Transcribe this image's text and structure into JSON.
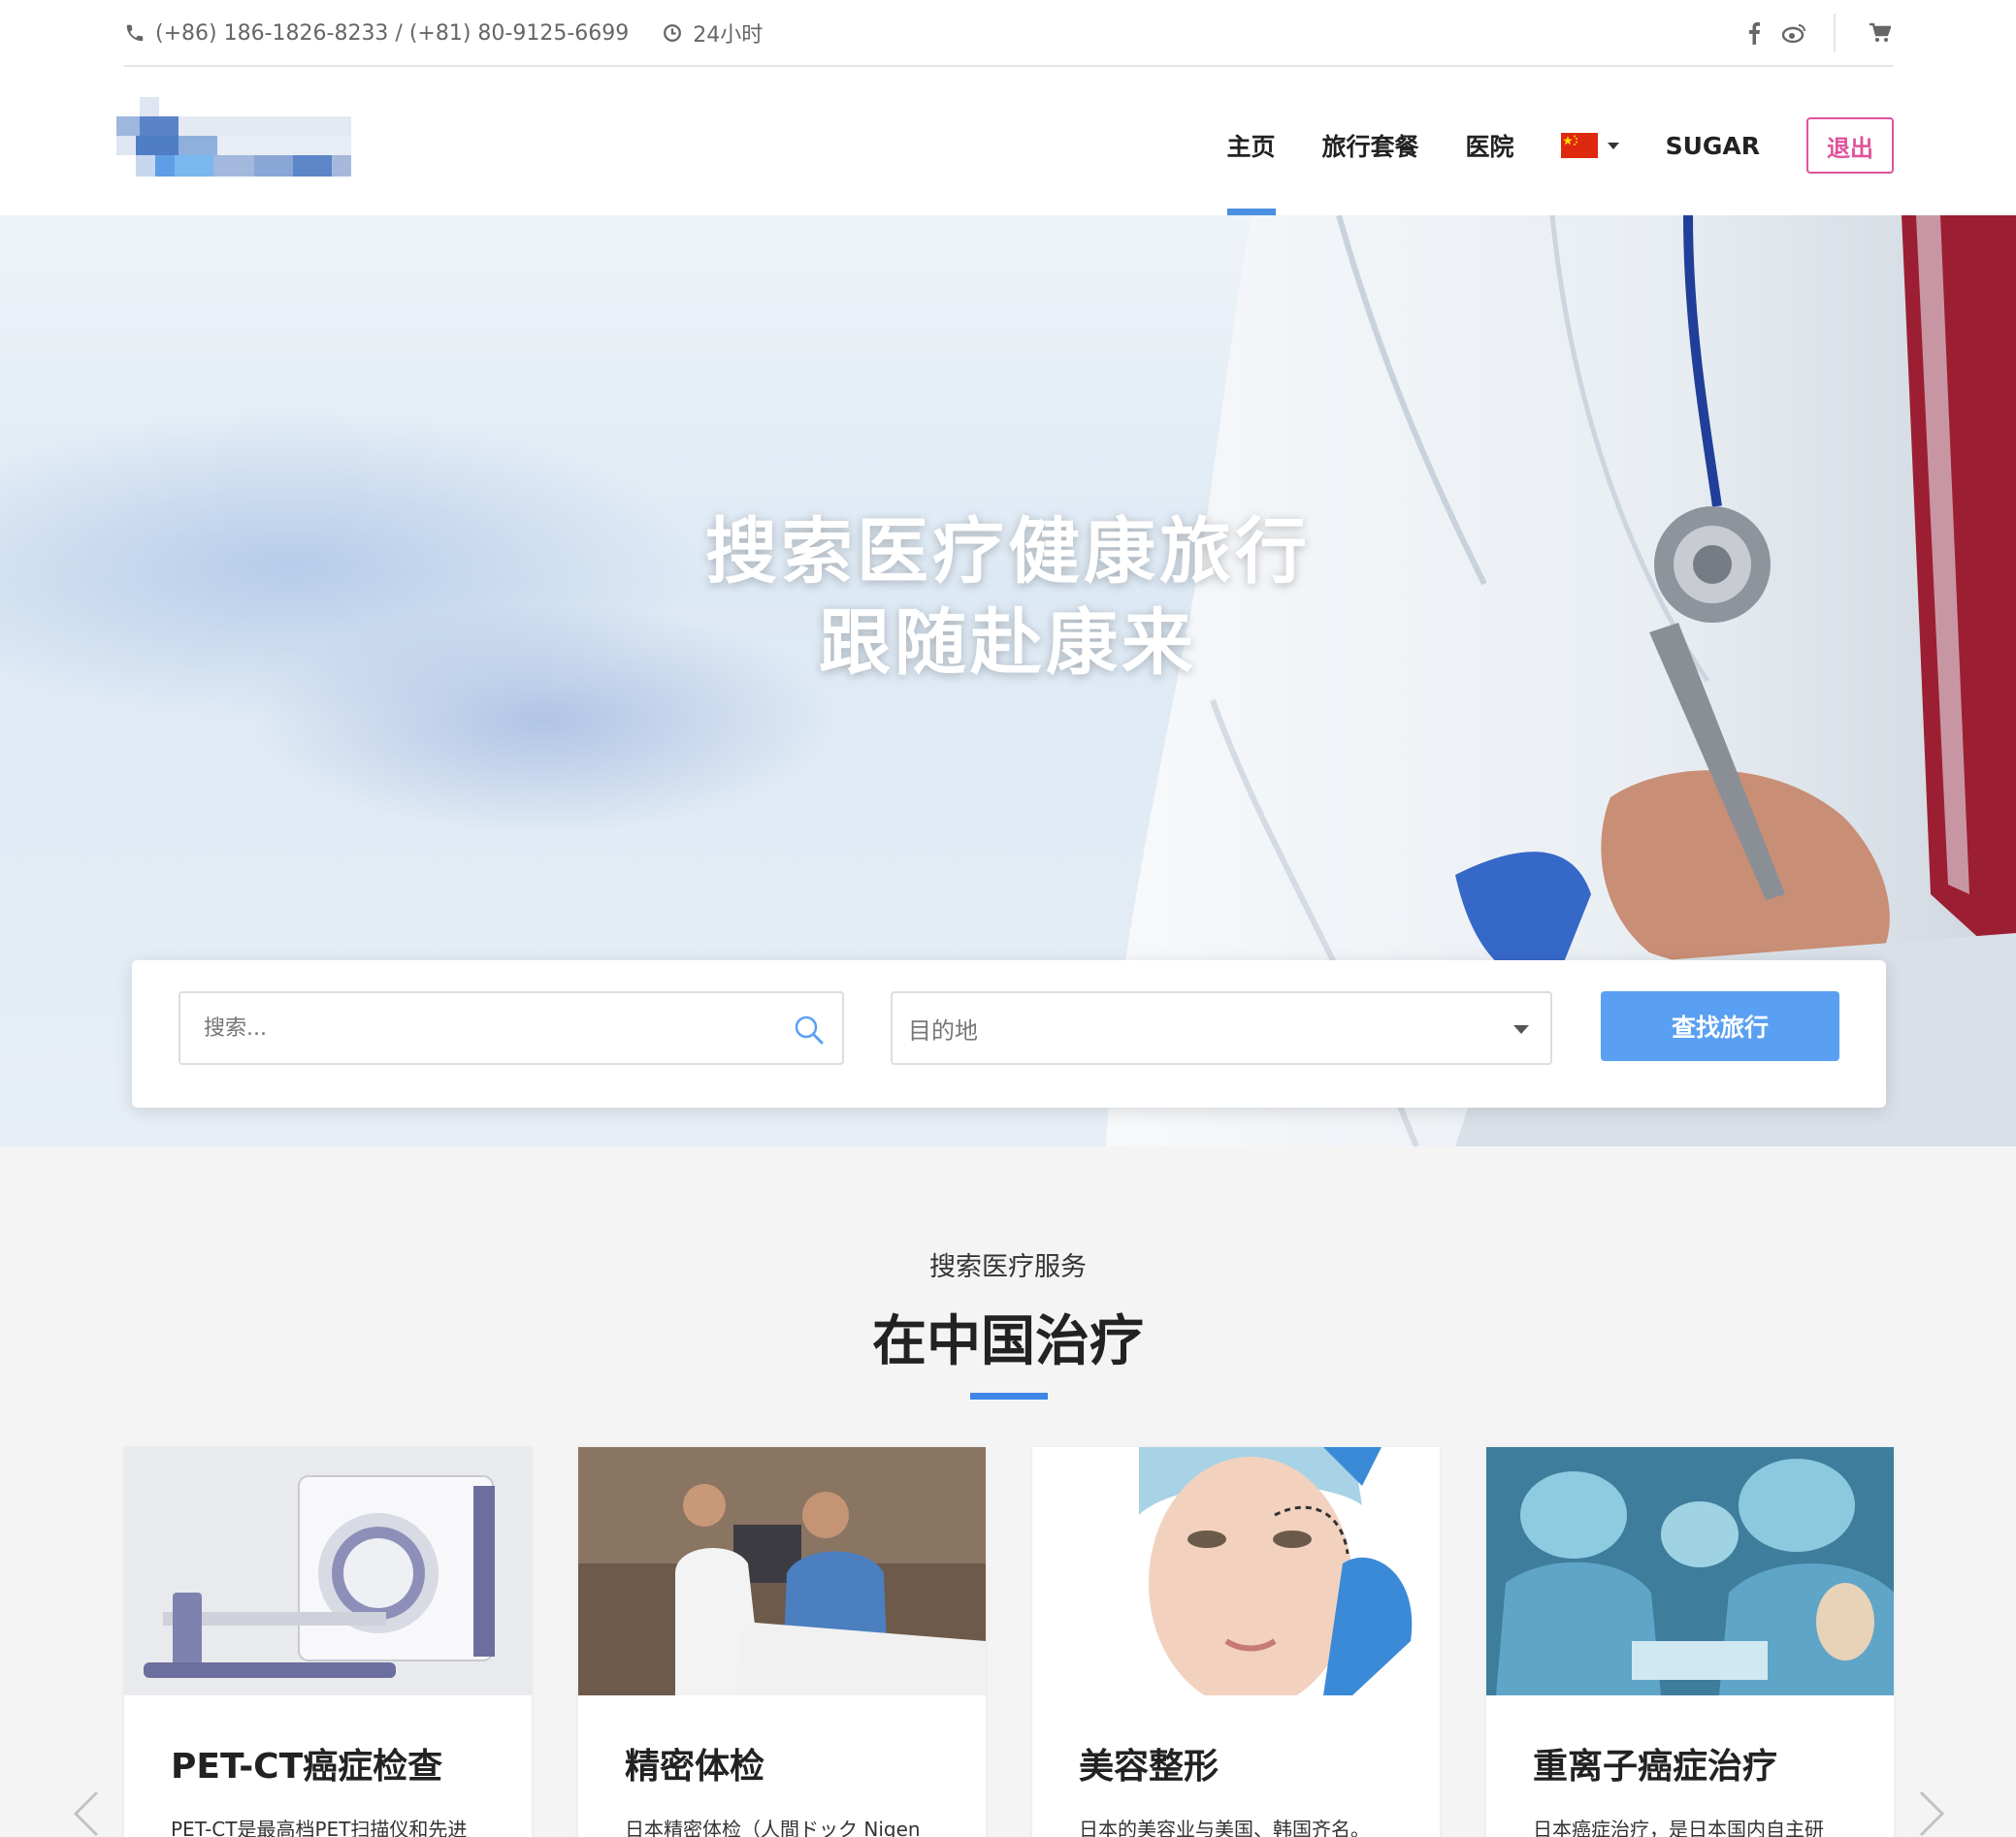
{
  "topbar": {
    "phone": "(+86) 186-1826-8233 / (+81) 80-9125-6699",
    "hours": "24小时"
  },
  "header": {
    "nav": [
      "主页",
      "旅行套餐",
      "医院"
    ],
    "user": "SUGAR",
    "logout": "退出"
  },
  "hero": {
    "title_line1": "搜索医疗健康旅行",
    "title_line2": "跟随赴康来",
    "search_placeholder": "搜索...",
    "destination": "目的地",
    "find_button": "查找旅行"
  },
  "services": {
    "subtitle": "搜索医疗服务",
    "title": "在中国治疗",
    "cards": [
      {
        "title": "PET-CT癌症检查",
        "desc": "PET-CT是最高档PET扫描仪和先进"
      },
      {
        "title": "精密体检",
        "desc": "日本精密体检（人間ドック Nigen"
      },
      {
        "title": "美容整形",
        "desc": "日本的美容业与美国、韩国齐名。"
      },
      {
        "title": "重离子癌症治疗",
        "desc": "日本癌症治疗，是日本国内自主研"
      }
    ]
  },
  "colors": {
    "accent": "#4a8fe0",
    "button": "#5aa0f2",
    "logout": "#e0529b"
  }
}
